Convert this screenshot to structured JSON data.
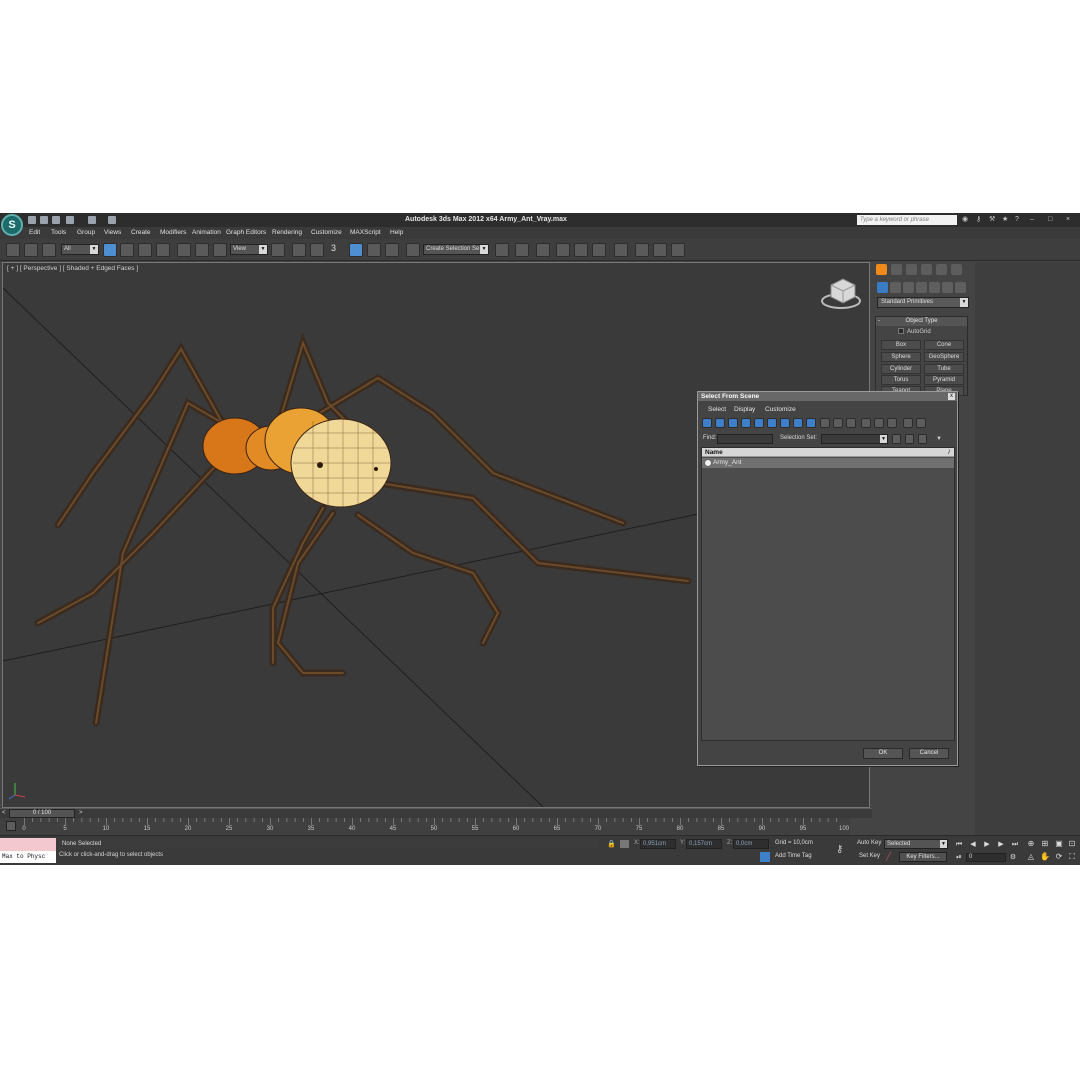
{
  "window": {
    "title": "Autodesk 3ds Max  2012 x64    Army_Ant_Vray.max",
    "logo": "3ds-max-logo",
    "search_placeholder": "Type a keyword or phrase"
  },
  "menu": [
    "Edit",
    "Tools",
    "Group",
    "Views",
    "Create",
    "Modifiers",
    "Animation",
    "Graph Editors",
    "Rendering",
    "Customize",
    "MAXScript",
    "Help"
  ],
  "toolbar": {
    "filter_value": "All",
    "ref_coord_value": "View",
    "snap_label": "3",
    "selection_set_placeholder": "Create Selection Se"
  },
  "viewport": {
    "label": "[ + ] [ Perspective ] [ Shaded + Edged Faces ]"
  },
  "command_panel": {
    "category": "Standard Primitives",
    "rollout_title": "Object Type",
    "autogrid_label": "AutoGrid",
    "primitives": [
      "Box",
      "Cone",
      "Sphere",
      "GeoSphere",
      "Cylinder",
      "Tube",
      "Torus",
      "Pyramid",
      "Teapot",
      "Plane"
    ]
  },
  "dialog": {
    "title": "Select From Scene",
    "close": "x",
    "menus": [
      "Select",
      "Display",
      "Customize"
    ],
    "find_label": "Find:",
    "find_value": "",
    "selection_set_label": "Selection Set:",
    "list_header": "Name",
    "sort_indicator": "/",
    "objects": [
      "Army_Ant"
    ],
    "ok_label": "OK",
    "cancel_label": "Cancel"
  },
  "time_slider": {
    "position_label": "0 / 100",
    "prev": "<",
    "next": ">"
  },
  "trackbar": {
    "ticks": [
      "0",
      "5",
      "10",
      "15",
      "20",
      "25",
      "30",
      "35",
      "40",
      "45",
      "50",
      "55",
      "60",
      "65",
      "70",
      "75",
      "80",
      "85",
      "90",
      "95",
      "100"
    ]
  },
  "status": {
    "listener_text": "Max to Physc",
    "selection_text": "None Selected",
    "prompt_text": "Click or click-and-drag to select objects",
    "x_label": "X:",
    "x_value": "0,951cm",
    "y_label": "Y:",
    "y_value": "0,157cm",
    "z_label": "Z:",
    "z_value": "0,0cm",
    "grid_text": "Grid = 10,0cm",
    "add_time_tag": "Add Time Tag",
    "auto_key": "Auto Key",
    "set_key": "Set Key",
    "selected_dropdown": "Selected",
    "key_filters": "Key Filters...",
    "frame_value": "0"
  },
  "colors": {
    "ui_background": "#444444",
    "viewport_background": "#3a3a3a",
    "accent_blue": "#3d7fc9",
    "ant_body": "#e8a030",
    "ant_head": "#f0d9a0"
  }
}
